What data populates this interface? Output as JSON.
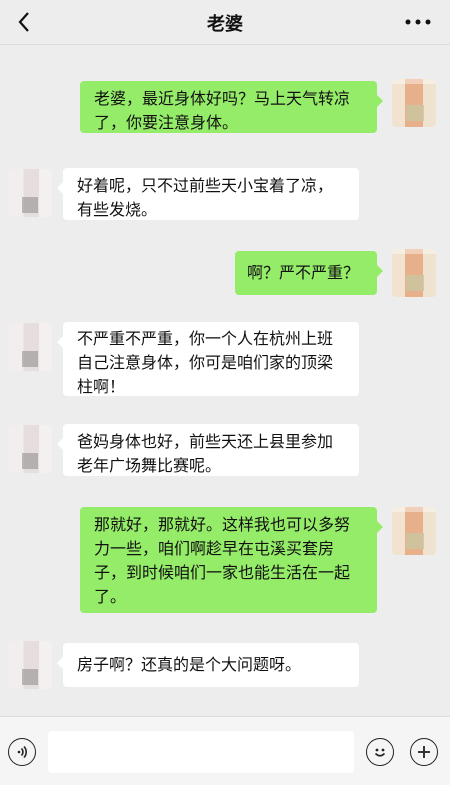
{
  "header": {
    "title": "老婆"
  },
  "messages": [
    {
      "side": "me",
      "text": "老婆，最近身体好吗？马上天气转凉了，你要注意身体。"
    },
    {
      "side": "other",
      "text": "好着呢，只不过前些天小宝着了凉，有些发烧。"
    },
    {
      "side": "me",
      "text": "啊？严不严重？"
    },
    {
      "side": "other",
      "text": "不严重不严重，你一个人在杭州上班自己注意身体，你可是咱们家的顶梁柱啊！"
    },
    {
      "side": "other",
      "text": "爸妈身体也好，前些天还上县里参加老年广场舞比赛呢。"
    },
    {
      "side": "me",
      "text": "那就好，那就好。这样我也可以多努力一些，咱们啊趁早在屯溪买套房子，到时候咱们一家也能生活在一起了。"
    },
    {
      "side": "other",
      "text": "房子啊？还真的是个大问题呀。"
    }
  ],
  "bottom_bar": {
    "input_value": ""
  },
  "colors": {
    "my_bubble": "#95ec69",
    "other_bubble": "#ffffff",
    "background": "#ededed"
  }
}
